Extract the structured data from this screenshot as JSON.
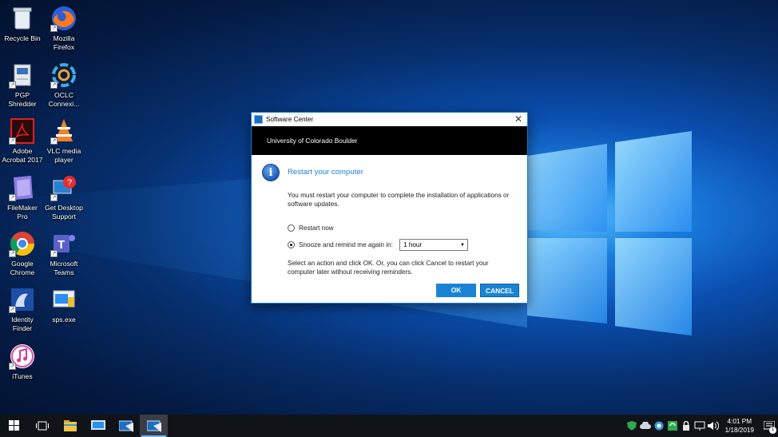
{
  "desktop": {
    "icons": [
      {
        "label": "Recycle Bin"
      },
      {
        "label": "Mozilla\nFirefox"
      },
      {
        "label": "PGP\nShredder"
      },
      {
        "label": "OCLC\nConnexi..."
      },
      {
        "label": "Adobe\nAcrobat 2017"
      },
      {
        "label": "VLC media\nplayer"
      },
      {
        "label": "FileMaker\nPro"
      },
      {
        "label": "Get Desktop\nSupport"
      },
      {
        "label": "Google\nChrome"
      },
      {
        "label": "Microsoft\nTeams"
      },
      {
        "label": "Identity\nFinder"
      },
      {
        "label": "sps.exe"
      },
      {
        "label": "iTunes"
      }
    ]
  },
  "dialog": {
    "title": "Software Center",
    "banner": "University of Colorado Boulder",
    "heading": "Restart your computer",
    "message": "You must restart your computer to complete the installation of applications or software updates.",
    "options": [
      {
        "label": "Restart now",
        "checked": false
      },
      {
        "label": "Snooze and remind me again in:",
        "checked": true
      }
    ],
    "snooze_value": "1 hour",
    "hint": "Select an action and click OK.  Or, you can click Cancel to restart your computer later without receiving reminders.",
    "ok_label": "OK",
    "cancel_label": "CANCEL",
    "close_glyph": "✕"
  },
  "taskbar": {
    "time": "4:01 PM",
    "date": "1/18/2019",
    "notification_count": "1"
  },
  "colors": {
    "accent": "#1a84d4",
    "heading": "#1a7fd2",
    "banner": "#000000"
  }
}
